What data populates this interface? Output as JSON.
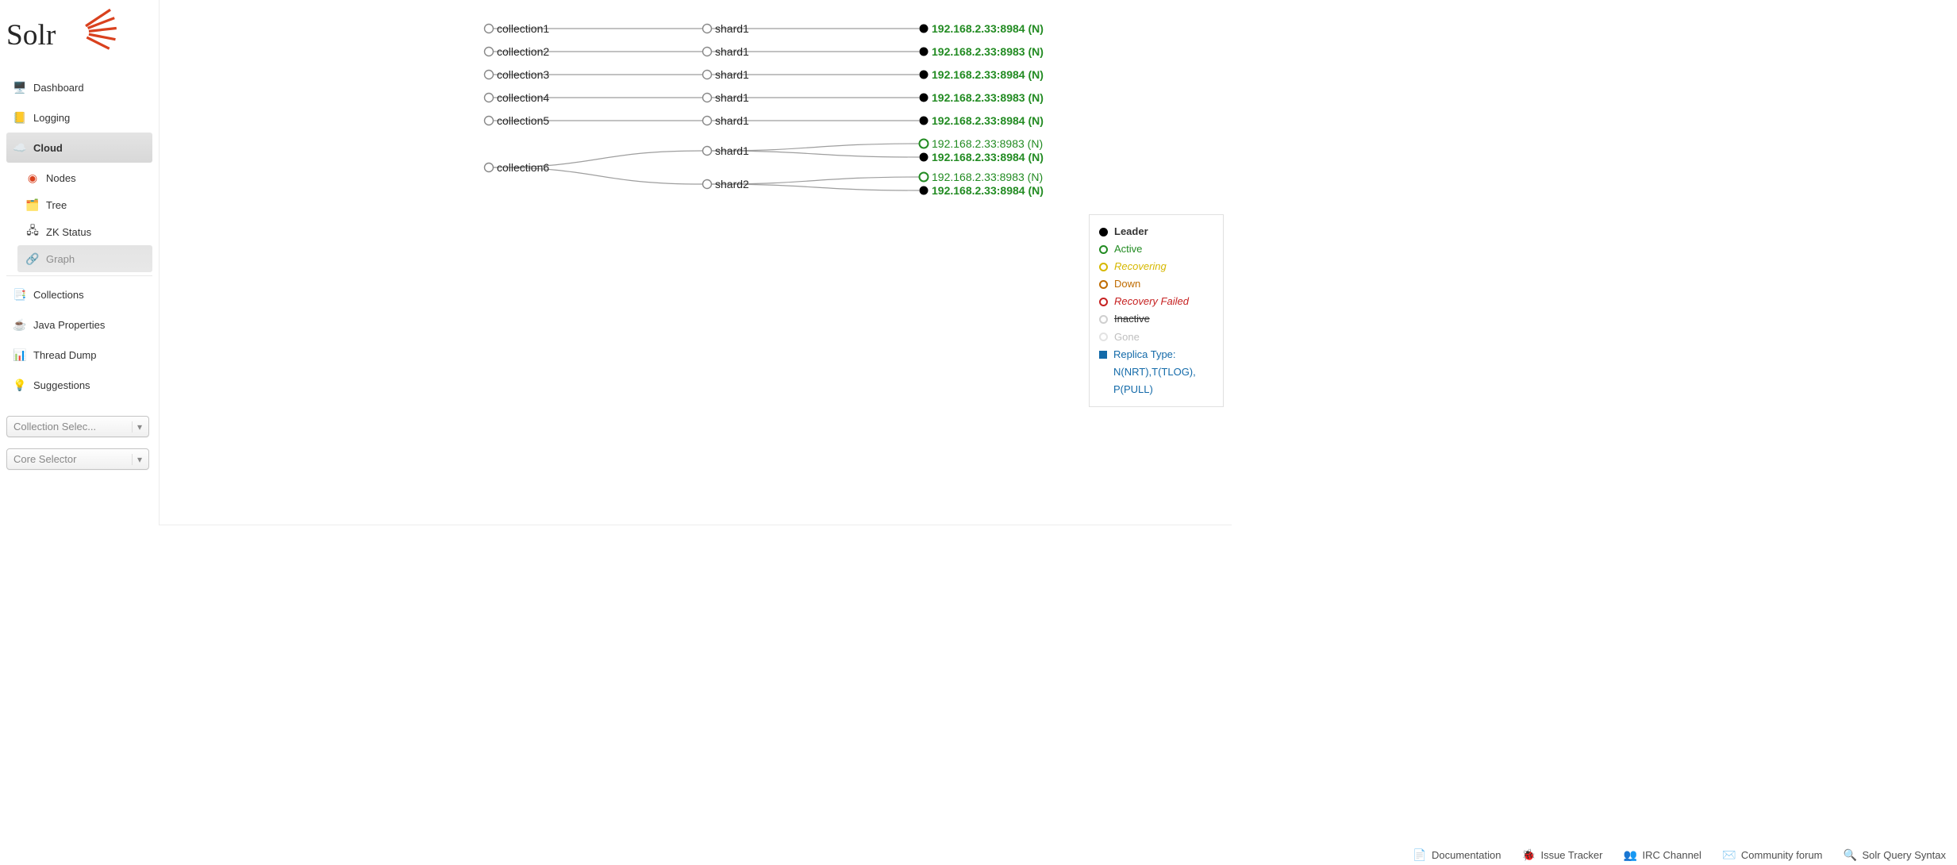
{
  "nav": {
    "dashboard": "Dashboard",
    "logging": "Logging",
    "cloud": "Cloud",
    "cloud_sub": {
      "nodes": "Nodes",
      "tree": "Tree",
      "zk": "ZK Status",
      "graph": "Graph"
    },
    "collections": "Collections",
    "javaprops": "Java Properties",
    "threaddump": "Thread Dump",
    "suggestions": "Suggestions"
  },
  "selectors": {
    "collection": "Collection Selec...",
    "core": "Core Selector"
  },
  "graph": {
    "rows": [
      {
        "collection": "collection1",
        "shard": "shard1",
        "replica": "192.168.2.33:8984 (N)",
        "leader": true
      },
      {
        "collection": "collection2",
        "shard": "shard1",
        "replica": "192.168.2.33:8983 (N)",
        "leader": true
      },
      {
        "collection": "collection3",
        "shard": "shard1",
        "replica": "192.168.2.33:8984 (N)",
        "leader": true
      },
      {
        "collection": "collection4",
        "shard": "shard1",
        "replica": "192.168.2.33:8983 (N)",
        "leader": true
      },
      {
        "collection": "collection5",
        "shard": "shard1",
        "replica": "192.168.2.33:8984 (N)",
        "leader": true
      }
    ],
    "c6": {
      "name": "collection6",
      "shard1": {
        "name": "shard1",
        "r1": "192.168.2.33:8983 (N)",
        "r2": "192.168.2.33:8984 (N)"
      },
      "shard2": {
        "name": "shard2",
        "r1": "192.168.2.33:8983 (N)",
        "r2": "192.168.2.33:8984 (N)"
      }
    }
  },
  "legend": {
    "leader": "Leader",
    "active": "Active",
    "recovering": "Recovering",
    "down": "Down",
    "recoveryfailed": "Recovery Failed",
    "inactive": "Inactive",
    "gone": "Gone",
    "replica1": "Replica Type:",
    "replica2": "N(NRT),T(TLOG),",
    "replica3": "P(PULL)"
  },
  "footer": {
    "doc": "Documentation",
    "issue": "Issue Tracker",
    "irc": "IRC Channel",
    "forum": "Community forum",
    "syntax": "Solr Query Syntax"
  }
}
